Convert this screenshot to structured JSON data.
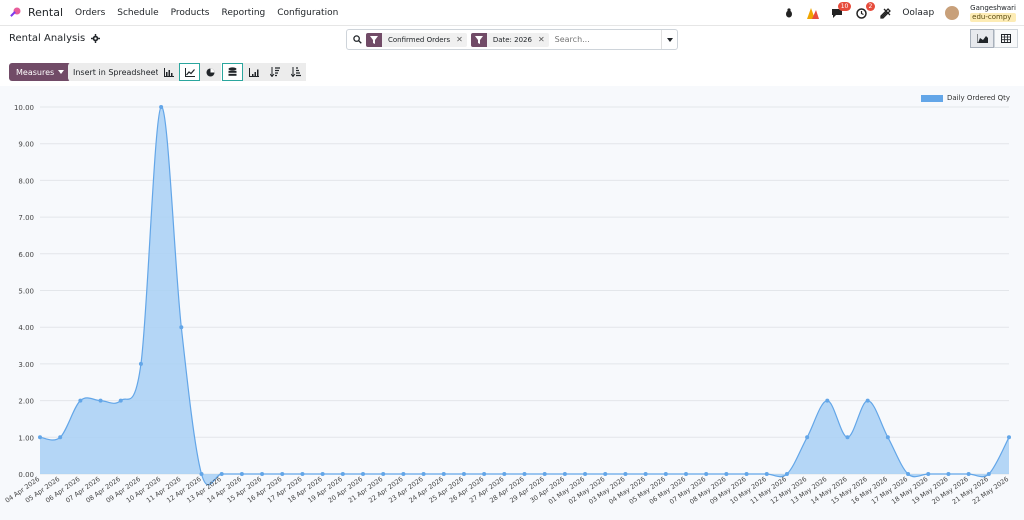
{
  "navbar": {
    "app_name": "Rental",
    "menu": [
      "Orders",
      "Schedule",
      "Products",
      "Reporting",
      "Configuration"
    ],
    "chat_badge": "10",
    "activity_badge": "2",
    "company": "Oolaap",
    "user_name": "Gangeshwari",
    "database": "edu-compy"
  },
  "control": {
    "title": "Rental Analysis",
    "facets": [
      {
        "label": "Confirmed Orders"
      },
      {
        "label": "Date: 2026"
      }
    ],
    "search_placeholder": "Search..."
  },
  "toolbar": {
    "measures_label": "Measures",
    "insert_label": "Insert in Spreadsheet"
  },
  "colors": {
    "accent": "#714b67",
    "series_fill": "#a8d0f5",
    "series_line": "#63a6e8",
    "active_border": "#2ba69e"
  },
  "chart_data": {
    "type": "area",
    "series": [
      {
        "name": "Daily Ordered Qty",
        "values": [
          1,
          1,
          2,
          2,
          2,
          3,
          10,
          4,
          0,
          0,
          0,
          0,
          0,
          0,
          0,
          0,
          0,
          0,
          0,
          0,
          0,
          0,
          0,
          0,
          0,
          0,
          0,
          0,
          0,
          0,
          0,
          0,
          0,
          0,
          0,
          0,
          0,
          0,
          1,
          2,
          1,
          2,
          1,
          0,
          0,
          0,
          0,
          0,
          1
        ]
      }
    ],
    "x": [
      "04 Apr 2026",
      "05 Apr 2026",
      "06 Apr 2026",
      "07 Apr 2026",
      "08 Apr 2026",
      "09 Apr 2026",
      "10 Apr 2026",
      "11 Apr 2026",
      "12 Apr 2026",
      "13 Apr 2026",
      "14 Apr 2026",
      "15 Apr 2026",
      "16 Apr 2026",
      "17 Apr 2026",
      "18 Apr 2026",
      "19 Apr 2026",
      "20 Apr 2026",
      "21 Apr 2026",
      "22 Apr 2026",
      "23 Apr 2026",
      "24 Apr 2026",
      "25 Apr 2026",
      "26 Apr 2026",
      "27 Apr 2026",
      "28 Apr 2026",
      "29 Apr 2026",
      "30 Apr 2026",
      "01 May 2026",
      "02 May 2026",
      "03 May 2026",
      "04 May 2026",
      "05 May 2026",
      "06 May 2026",
      "07 May 2026",
      "08 May 2026",
      "09 May 2026",
      "10 May 2026",
      "11 May 2026",
      "12 May 2026",
      "13 May 2026",
      "14 May 2026",
      "15 May 2026",
      "16 May 2026",
      "17 May 2026",
      "18 May 2026",
      "19 May 2026",
      "20 May 2026",
      "21 May 2026",
      "22 May 2026"
    ],
    "yticks": [
      "0.00",
      "1.00",
      "2.00",
      "3.00",
      "4.00",
      "5.00",
      "6.00",
      "7.00",
      "8.00",
      "9.00",
      "10.00"
    ],
    "ylim": [
      0,
      10
    ],
    "grid": true,
    "legend": "top-right"
  }
}
